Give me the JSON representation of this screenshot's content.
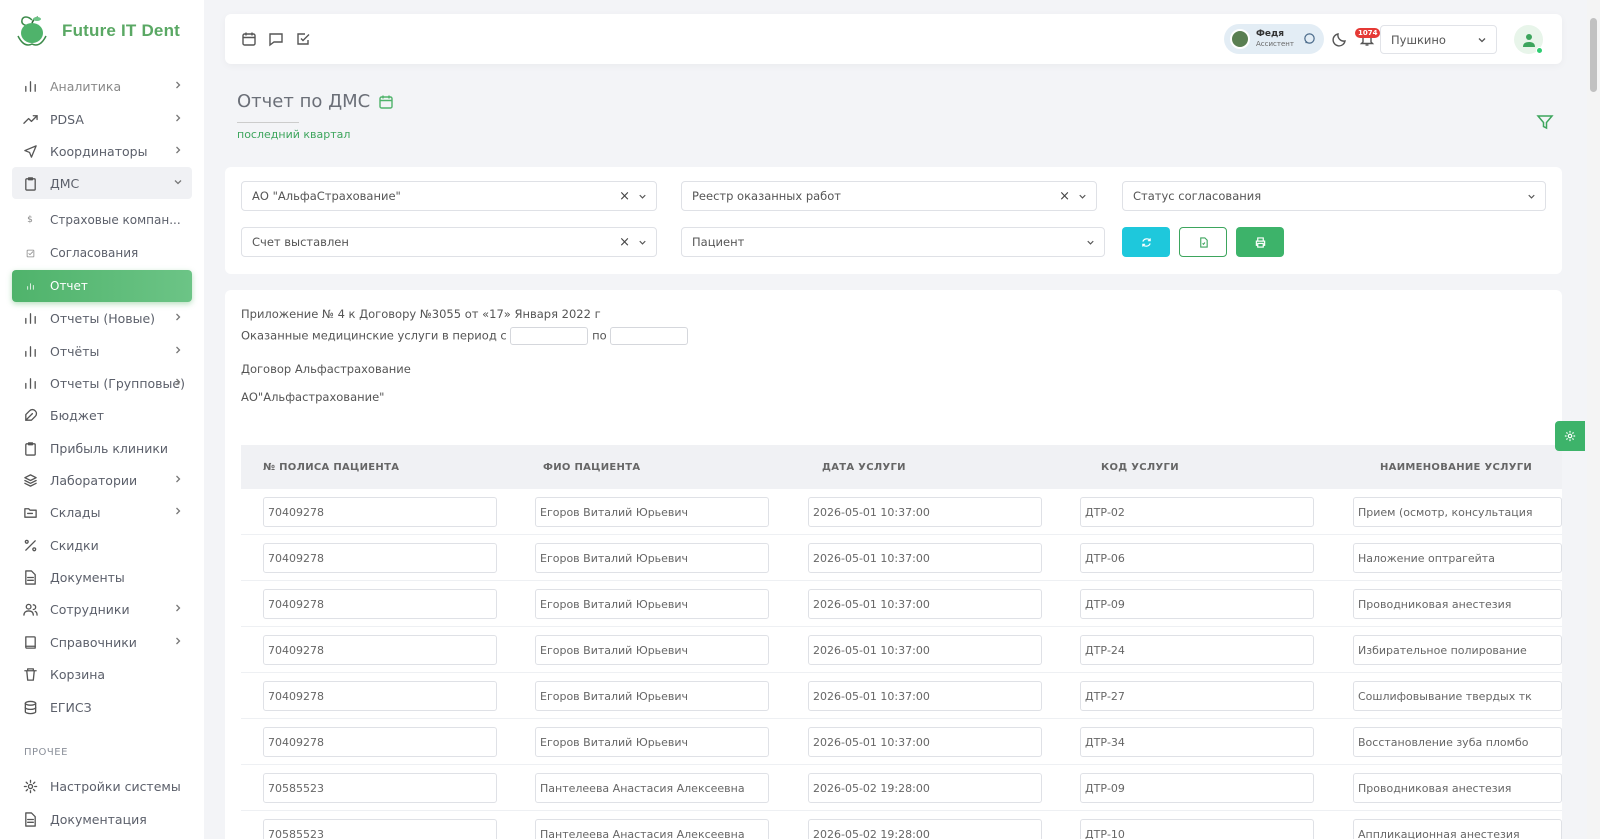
{
  "app": {
    "name": "Future IT Dent"
  },
  "sidebar": {
    "items": [
      {
        "label": "Аналитика",
        "icon": "bar-chart-icon",
        "chevron": true
      },
      {
        "label": "PDSA",
        "icon": "trending-up-icon",
        "chevron": true
      },
      {
        "label": "Координаторы",
        "icon": "send-icon",
        "chevron": true
      },
      {
        "label": "ДМС",
        "icon": "clipboard-icon",
        "chevron": "down"
      },
      {
        "label": "Страховые компан...",
        "icon": "dollar-icon",
        "sub": true
      },
      {
        "label": "Согласования",
        "icon": "check-square-icon",
        "sub": true
      },
      {
        "label": "Отчет",
        "icon": "bar-chart-icon",
        "sub": true,
        "active": true
      },
      {
        "label": "Отчеты (Новые)",
        "icon": "bar-chart-icon",
        "chevron": true
      },
      {
        "label": "Отчёты",
        "icon": "bar-chart-icon",
        "chevron": true
      },
      {
        "label": "Отчеты (Групповые)",
        "icon": "bar-chart-icon",
        "chevron": true
      },
      {
        "label": "Бюджет",
        "icon": "feather-icon"
      },
      {
        "label": "Прибыль клиники",
        "icon": "clipboard-icon"
      },
      {
        "label": "Лаборатории",
        "icon": "layers-icon",
        "chevron": true
      },
      {
        "label": "Склады",
        "icon": "folder-icon",
        "chevron": true
      },
      {
        "label": "Скидки",
        "icon": "percent-icon"
      },
      {
        "label": "Документы",
        "icon": "file-text-icon"
      },
      {
        "label": "Сотрудники",
        "icon": "users-icon",
        "chevron": true
      },
      {
        "label": "Справочники",
        "icon": "book-icon",
        "chevron": true
      },
      {
        "label": "Корзина",
        "icon": "trash-icon"
      },
      {
        "label": "ЕГИСЗ",
        "icon": "database-icon"
      }
    ],
    "section_label": "ПРОЧЕЕ",
    "bottom_items": [
      {
        "label": "Настройки системы",
        "icon": "settings-icon"
      },
      {
        "label": "Документация",
        "icon": "file-text-icon"
      }
    ]
  },
  "topbar": {
    "assistant_name": "Федя",
    "assistant_role": "Ассистент",
    "notifications_count": "1074",
    "city": "Пушкино"
  },
  "page": {
    "title": "Отчет по ДМС",
    "subtitle": "последний квартал"
  },
  "filters": {
    "insurer": "АО \"АльфаСтрахование\"",
    "register": "Реестр оказанных работ",
    "status_placeholder": "Статус согласования",
    "invoice": "Счет выставлен",
    "patient_placeholder": "Пациент"
  },
  "report": {
    "line1": "Приложение № 4 к Договору №3055 от «17» Января 2022 г",
    "period_label": "Оказанные медицинские услуги в период с",
    "period_to": "по",
    "contract": "Договор Альфастрахование",
    "company": "АО\"Альфастрахование\""
  },
  "table": {
    "columns": [
      "№ ПОЛИСА ПАЦИЕНТА",
      "ФИО ПАЦИЕНТА",
      "ДАТА УСЛУГИ",
      "КОД УСЛУГИ",
      "НАИМЕНОВАНИЕ УСЛУГИ"
    ],
    "rows": [
      [
        "70409278",
        "Егоров Виталий Юрьевич",
        "2026-05-01 10:37:00",
        "ДТР-02",
        "Прием (осмотр, консультация"
      ],
      [
        "70409278",
        "Егоров Виталий Юрьевич",
        "2026-05-01 10:37:00",
        "ДТР-06",
        "Наложение оптрагейта"
      ],
      [
        "70409278",
        "Егоров Виталий Юрьевич",
        "2026-05-01 10:37:00",
        "ДТР-09",
        "Проводниковая анестезия"
      ],
      [
        "70409278",
        "Егоров Виталий Юрьевич",
        "2026-05-01 10:37:00",
        "ДТР-24",
        "Избирательное полирование"
      ],
      [
        "70409278",
        "Егоров Виталий Юрьевич",
        "2026-05-01 10:37:00",
        "ДТР-27",
        "Сошлифовывание твердых тк"
      ],
      [
        "70409278",
        "Егоров Виталий Юрьевич",
        "2026-05-01 10:37:00",
        "ДТР-34",
        "Восстановление зуба пломбо"
      ],
      [
        "70585523",
        "Пантелеева Анастасия Алексеевна",
        "2026-05-02 19:28:00",
        "ДТР-09",
        "Проводниковая анестезия"
      ],
      [
        "70585523",
        "Пантелеева Анастасия Алексеевна",
        "2026-05-02 19:28:00",
        "ДТР-10",
        "Аппликационная анестезия"
      ]
    ]
  }
}
